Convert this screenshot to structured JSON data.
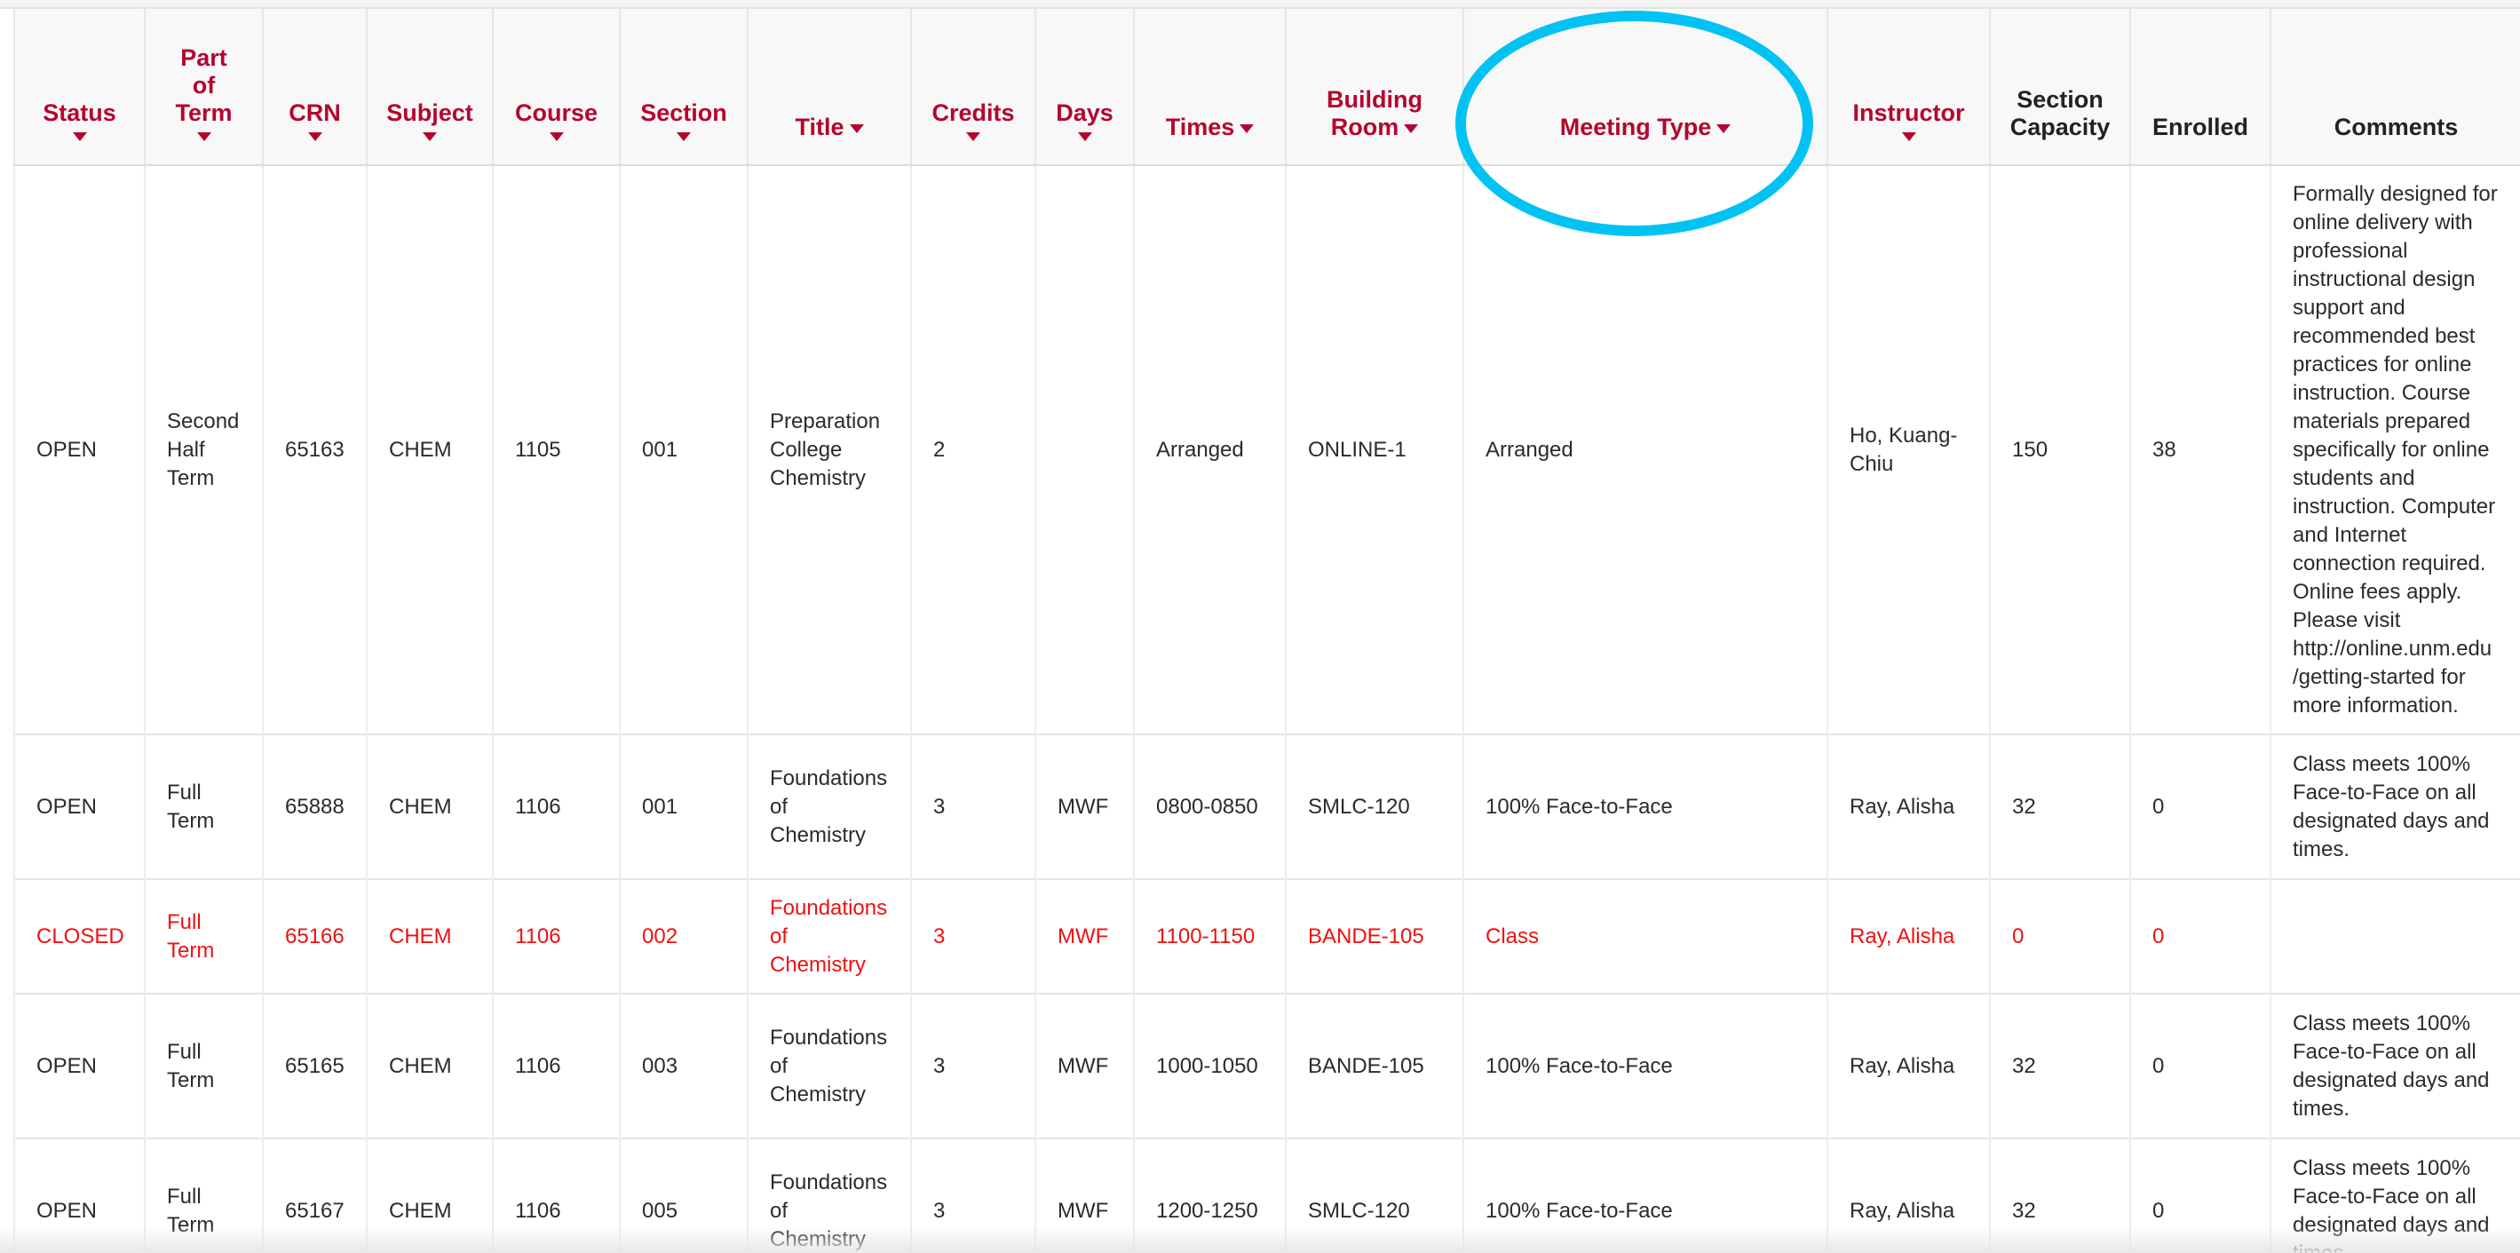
{
  "columns": {
    "status": "Status",
    "part_of_term": [
      "Part",
      "of",
      "Term"
    ],
    "crn": "CRN",
    "subject": "Subject",
    "course": "Course",
    "section": "Section",
    "title": "Title",
    "credits": "Credits",
    "days": "Days",
    "times": "Times",
    "building_room": [
      "Building",
      "Room"
    ],
    "meeting_type": "Meeting Type",
    "instructor": "Instructor",
    "section_capacity": [
      "Section",
      "Capacity"
    ],
    "enrolled": "Enrolled",
    "comments": "Comments"
  },
  "rows": [
    {
      "status": "OPEN",
      "part_of_term": [
        "Second",
        "Half",
        "Term"
      ],
      "crn": "65163",
      "subject": "CHEM",
      "course": "1105",
      "section": "001",
      "title": [
        "Preparation",
        "College",
        "Chemistry"
      ],
      "credits": "2",
      "days": "",
      "times": "Arranged",
      "building_room": "ONLINE-1",
      "meeting_type": "Arranged",
      "instructor": [
        "Ho, Kuang-",
        "Chiu"
      ],
      "section_capacity": "150",
      "enrolled": "38",
      "comments": [
        "Formally designed for",
        "online delivery with",
        "professional",
        "instructional design",
        "support and",
        "recommended best",
        "practices for online",
        "instruction. Course",
        "materials prepared",
        "specifically for online",
        "students and",
        "instruction. Computer",
        "and Internet",
        "connection required.",
        "Online fees apply.",
        "Please visit",
        "http://online.unm.edu",
        "/getting-started for",
        "more information."
      ]
    },
    {
      "status": "OPEN",
      "part_of_term": [
        "Full",
        "Term"
      ],
      "crn": "65888",
      "subject": "CHEM",
      "course": "1106",
      "section": "001",
      "title": [
        "Foundations",
        "of",
        "Chemistry"
      ],
      "credits": "3",
      "days": "MWF",
      "times": "0800-0850",
      "building_room": "SMLC-120",
      "meeting_type": "100% Face-to-Face",
      "instructor": [
        "Ray, Alisha"
      ],
      "section_capacity": "32",
      "enrolled": "0",
      "comments": [
        "Class meets 100%",
        "Face-to-Face on all",
        "designated days and",
        "times."
      ]
    },
    {
      "status": "CLOSED",
      "part_of_term": [
        "Full",
        "Term"
      ],
      "crn": "65166",
      "subject": "CHEM",
      "course": "1106",
      "section": "002",
      "title": [
        "Foundations",
        "of",
        "Chemistry"
      ],
      "credits": "3",
      "days": "MWF",
      "times": "1100-1150",
      "building_room": "BANDE-105",
      "meeting_type": "Class",
      "instructor": [
        "Ray, Alisha"
      ],
      "section_capacity": "0",
      "enrolled": "0",
      "comments": []
    },
    {
      "status": "OPEN",
      "part_of_term": [
        "Full",
        "Term"
      ],
      "crn": "65165",
      "subject": "CHEM",
      "course": "1106",
      "section": "003",
      "title": [
        "Foundations",
        "of",
        "Chemistry"
      ],
      "credits": "3",
      "days": "MWF",
      "times": "1000-1050",
      "building_room": "BANDE-105",
      "meeting_type": "100% Face-to-Face",
      "instructor": [
        "Ray, Alisha"
      ],
      "section_capacity": "32",
      "enrolled": "0",
      "comments": [
        "Class meets 100%",
        "Face-to-Face on all",
        "designated days and",
        "times."
      ]
    },
    {
      "status": "OPEN",
      "part_of_term": [
        "Full",
        "Term"
      ],
      "crn": "65167",
      "subject": "CHEM",
      "course": "1106",
      "section": "005",
      "title": [
        "Foundations",
        "of",
        "Chemistry"
      ],
      "credits": "3",
      "days": "MWF",
      "times": "1200-1250",
      "building_room": "SMLC-120",
      "meeting_type": "100% Face-to-Face",
      "instructor": [
        "Ray, Alisha"
      ],
      "section_capacity": "32",
      "enrolled": "0",
      "comments": [
        "Class meets 100%",
        "Face-to-Face on all",
        "designated days and",
        "times."
      ]
    }
  ],
  "icons": {
    "sort": "caret-down-icon",
    "annotation": "highlight-circle"
  },
  "colors": {
    "header_link": "#b5052e",
    "closed_row": "#ee1111",
    "annotation_ring": "#00c3f3",
    "header_bg": "#f8f8f8"
  }
}
